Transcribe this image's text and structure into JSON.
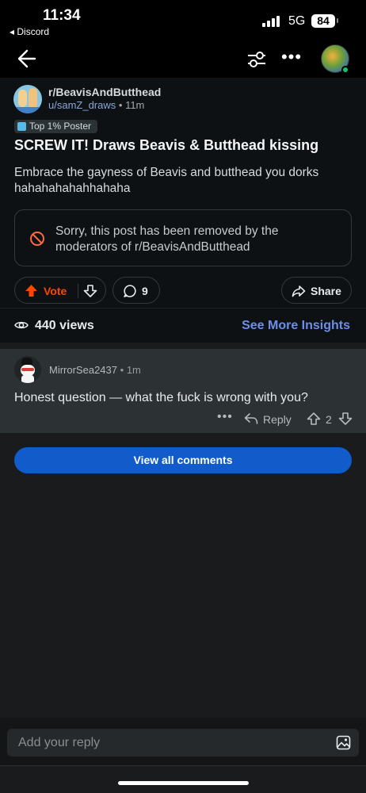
{
  "status_bar": {
    "time": "11:34",
    "back_app": "◂ Discord",
    "network": "5G",
    "battery": "84"
  },
  "nav": {
    "back_icon": "arrow-left-icon",
    "filter_icon": "sliders-icon",
    "more_icon": "more-horizontal-icon",
    "more": "•••",
    "avatar": "user-avatar"
  },
  "post": {
    "subreddit": "r/BeavisAndButthead",
    "author": "u/samZ_draws",
    "separator": "•",
    "age": "11m",
    "flair": "Top 1% Poster",
    "title": "SCREW IT! Draws Beavis & Butthead kissing",
    "body": "Embrace the gayness of Beavis and butthead you dorks hahahahahahhahaha",
    "removed_notice": "Sorry, this post has been removed by the moderators of r/BeavisAndButthead",
    "vote_label": "Vote",
    "comment_count": "9",
    "share_label": "Share"
  },
  "insights": {
    "views": "440 views",
    "link": "See More Insights"
  },
  "comment": {
    "username": "MirrorSea2437",
    "separator": "•",
    "age": "1m",
    "text": "Honest question — what the fuck is wrong with you?",
    "more": "•••",
    "reply_label": "Reply",
    "score": "2"
  },
  "view_all": "View all comments",
  "reply_bar": {
    "placeholder": "Add your reply"
  },
  "colors": {
    "accent": "#ff4500",
    "link": "#6d8fe8",
    "button": "#115bca",
    "background": "#1a1b1d",
    "post_bg": "#0e1113",
    "comment_bg": "#2c3134"
  }
}
